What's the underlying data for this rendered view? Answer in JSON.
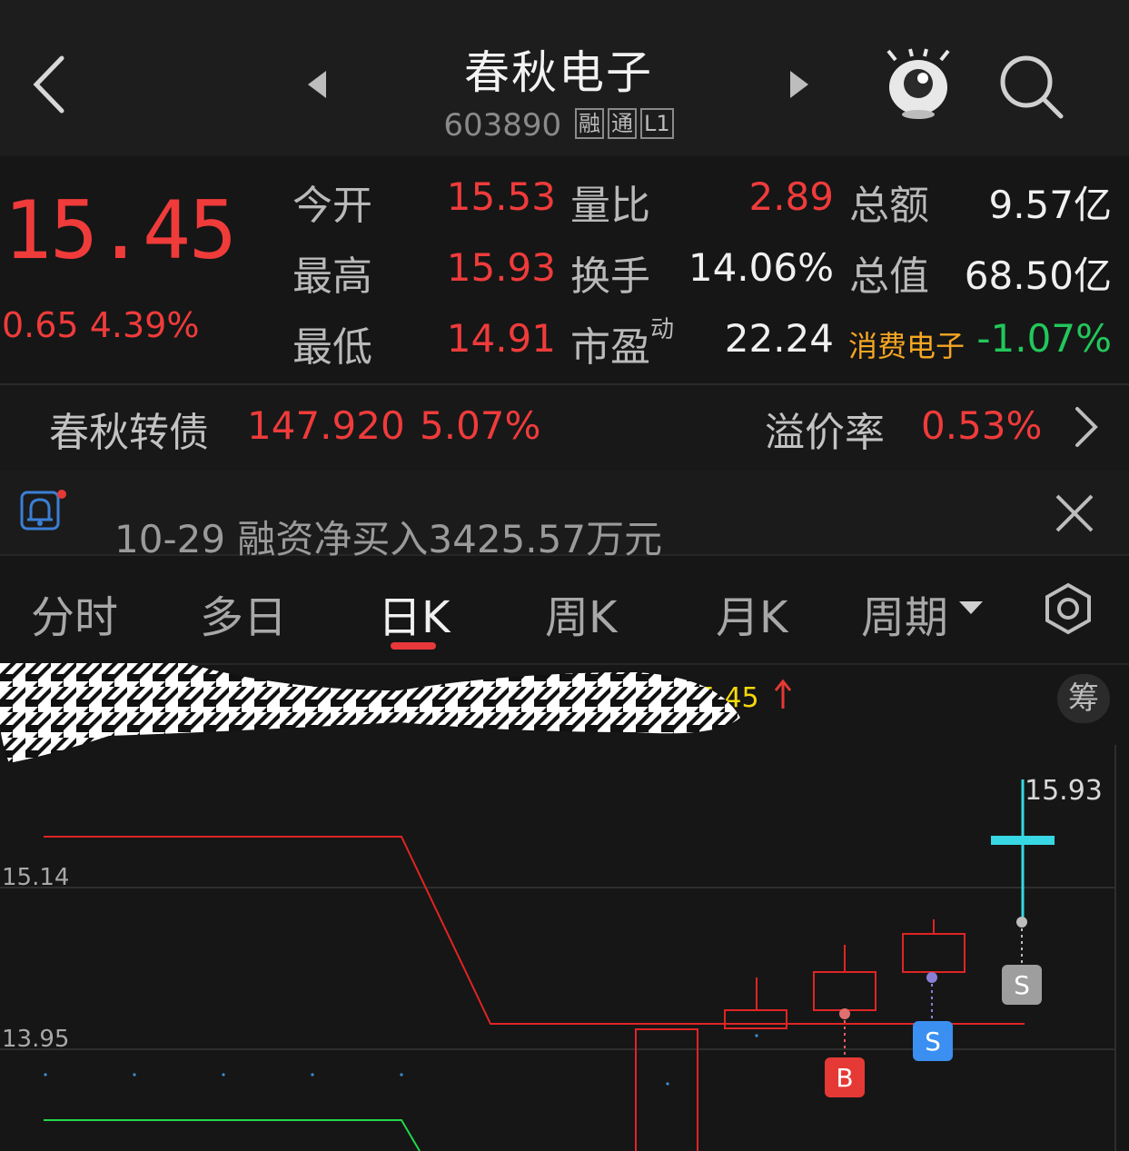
{
  "header": {
    "stock_name": "春秋电子",
    "stock_code": "603890",
    "tags": [
      "融",
      "通",
      "L1"
    ]
  },
  "quote": {
    "price": "15.45",
    "change": "0.65",
    "change_pct": "4.39%",
    "rows": [
      {
        "l1": "今开",
        "v1": "15.53",
        "l2": "量比",
        "v2": "2.89",
        "l3": "总额",
        "v3": "9.57亿"
      },
      {
        "l1": "最高",
        "v1": "15.93",
        "l2": "换手",
        "v2": "14.06%",
        "l3": "总值",
        "v3": "68.50亿"
      },
      {
        "l1": "最低",
        "v1": "14.91",
        "l2": "市盈",
        "l2_sup": "动",
        "v2": "22.24",
        "l3": "消费电子",
        "v3": "-1.07%"
      }
    ]
  },
  "bond": {
    "name": "春秋转债",
    "price": "147.920",
    "change_pct": "5.07%",
    "premium_label": "溢价率",
    "premium_value": "0.53%"
  },
  "notice": {
    "text": "10-29 融资净买入3425.57万元"
  },
  "tabs": [
    "分时",
    "多日",
    "日K",
    "周K",
    "月K",
    "周期"
  ],
  "active_tab": "日K",
  "chart_header": {
    "partial_text": "高: 15.45",
    "chip_label": "筹"
  },
  "colors": {
    "up": "#f03b3b",
    "down": "#22c75b",
    "accent_cyan": "#37d7e3",
    "buy_badge": "#e53935",
    "sell_badge": "#3b8ff0"
  },
  "chart_data": {
    "type": "candlestick",
    "y_labels": [
      "15.14",
      "13.95"
    ],
    "max_label": "15.93",
    "markers": [
      "B",
      "S",
      "S"
    ],
    "last_candle": {
      "open": 15.53,
      "high": 15.93,
      "low": 14.91,
      "close": 15.45
    }
  }
}
